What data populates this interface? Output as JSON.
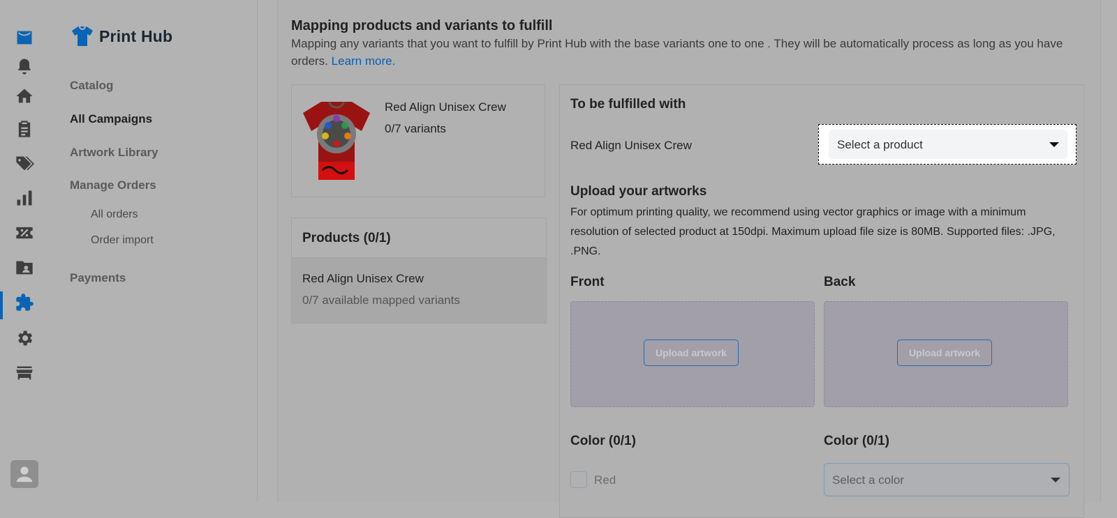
{
  "rail": {
    "icons": [
      "store-icon",
      "bell-icon",
      "home-icon",
      "clipboard-icon",
      "tags-icon",
      "bar-chart-icon",
      "discount-icon",
      "folder-user-icon",
      "puzzle-icon",
      "gear-icon",
      "storefront-icon"
    ],
    "active_icon": "puzzle-icon",
    "accent_color": "#0a64b4"
  },
  "brand": {
    "name": "Print Hub",
    "logo_color": "#0a64b4"
  },
  "nav": {
    "catalog": "Catalog",
    "all_campaigns": "All Campaigns",
    "artwork_library": "Artwork Library",
    "manage_orders": "Manage Orders",
    "all_orders": "All orders",
    "order_import": "Order import",
    "payments": "Payments"
  },
  "main": {
    "title": "Mapping products and variants to fulfill",
    "description": "Mapping any variants that you want to fulfill by Print Hub with the base variants one to one . They will be automatically process as long as you have orders.",
    "learn_more": "Learn more.",
    "product": {
      "name": "Red Align Unisex Crew",
      "variants": "0/7 variants"
    },
    "products_panel": {
      "title": "Products (0/1)",
      "items": [
        {
          "name": "Red Align Unisex Crew",
          "mapped": "0/7 available mapped variants"
        }
      ]
    },
    "fulfill": {
      "title": "To be fulfilled with",
      "product_label": "Red Align Unisex Crew",
      "select_placeholder": "Select a product"
    },
    "upload": {
      "title": "Upload your artworks",
      "description": "For optimum printing quality, we recommend using vector graphics or image with a minimum resolution of selected product at 150dpi. Maximum upload file size is 80MB. Supported files: .JPG, .PNG.",
      "front_label": "Front",
      "back_label": "Back",
      "button_label": "Upload artwork"
    },
    "color_left": {
      "title": "Color (0/1)",
      "option": "Red"
    },
    "color_right": {
      "title": "Color (0/1)",
      "select_placeholder": "Select a color"
    }
  }
}
